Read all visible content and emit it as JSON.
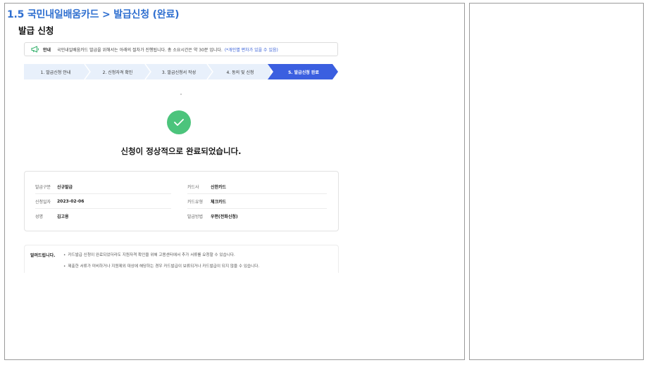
{
  "slide": {
    "title": "1.5 국민내일배움카드 > 발급신청 (완료)"
  },
  "page": {
    "heading": "발급 신청"
  },
  "notice": {
    "label": "안내",
    "text": "국민내일배움카드 발급을 위해서는 아래의 절차가 진행됩니다. 총 소요시간은 약 30분 입니다.",
    "highlight": "(*개인별 편차가 있을 수 있음)",
    "icon": "megaphone-icon"
  },
  "steps": [
    {
      "label": "1. 발급신청 안내"
    },
    {
      "label": "2. 신청자격 확인"
    },
    {
      "label": "3. 발급신청서 작성"
    },
    {
      "label": "4. 동의 및 신청"
    },
    {
      "label": "5. 발급신청 완료"
    }
  ],
  "active_step": 5,
  "complete": {
    "message": "신청이 정상적으로 완료되었습니다.",
    "icon": "check-icon"
  },
  "details": {
    "issue_type": {
      "key": "발급구분",
      "value": "신규발급"
    },
    "apply_date": {
      "key": "신청일자",
      "value": "2023-02-06"
    },
    "name": {
      "key": "성명",
      "value": "김고용"
    },
    "card_company": {
      "key": "카드사",
      "value": "신한카드"
    },
    "card_type": {
      "key": "카드유형",
      "value": "체크카드"
    },
    "issue_method": {
      "key": "발급방법",
      "value": "우편(전화신청)"
    }
  },
  "notes": {
    "title": "알려드립니다.",
    "items": [
      "카드발급 신청이 완료되었더라도 지원자격 확인을 위해 고용센터에서 추가 서류를 요청할 수 있습니다.",
      "제출한 서류가 미비하거나 지원제외 대상에 해당하는 경우 카드발급이 보류되거나 카드발급이 되지 않을 수 있습니다."
    ]
  },
  "colors": {
    "title_blue": "#2f6fd0",
    "step_active": "#3b5fe0",
    "step_inactive": "#e8f0fb",
    "success_green": "#4cc47c"
  }
}
